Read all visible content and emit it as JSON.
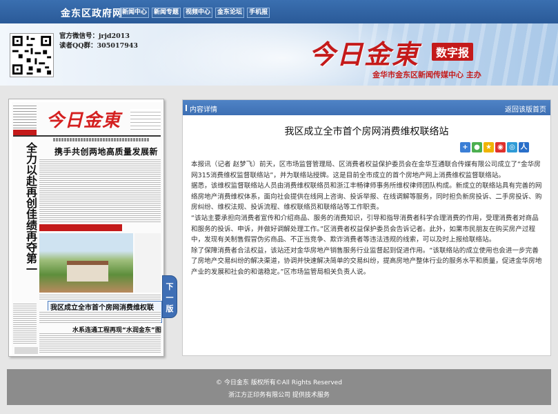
{
  "site": {
    "name": "金东区政府网",
    "nav": [
      "新闻中心",
      "新闻专题",
      "视频中心",
      "金东论坛",
      "手机报"
    ]
  },
  "banner": {
    "wechat": "官方微信号：jrjd2013",
    "qq": "读者QQ群：305017943",
    "logo_title": "今日金東",
    "logo_sub": "数字报",
    "tagline": "金华市金东区新闻传媒中心 主办"
  },
  "paper": {
    "masthead": "今日金東",
    "vertical_headline": "全力以赴再创佳绩再夺第一",
    "headline_main": "携手共创两地高质量发展新局面",
    "headline_article": "我区成立全市首个房网消费维权联络站",
    "headline_water": "水系连通工程再现“水润金东”图景",
    "next_page": "下一版"
  },
  "article": {
    "section_label": "内容详情",
    "back_link": "返回该版首页",
    "title": "我区成立全市首个房网消费维权联络站",
    "share_icons": [
      "plus-icon",
      "wechat-icon",
      "qzone-icon",
      "weibo-icon",
      "tencent-weibo-icon",
      "renren-icon"
    ],
    "paragraphs": [
      "本报讯（记者 赵梦飞）前天，区市场监督管理局、区消费者权益保护委员会在金华互通联合传媒有限公司成立了“金华房网315消费维权监督联络站”，并为联络站授牌。这是目前全市成立的首个房地产网上消费维权监督联络站。",
      "据悉，该维权监督联络站人员由消费维权联络员和浙江丰畅律师事务所维权律师团队构成。新成立的联络站具有完善的网络房地产消费维权体系，面向社会提供在线网上咨询、投诉举报、在线调解等服务，同时担负新房投诉、二手房投诉、购房纠纷、维权法规、投诉流程、维权联络员和联络站等工作职责。",
      "“该站主要承担向消费者宣传和介绍商品、服务的消费知识，引导和指导消费者科学合理消费的作用，受理消费者对商品和服务的投诉、申诉，并做好调解处理工作。”区消费者权益保护委员会告诉记者。此外，如果市民朋友在购买房产过程中，发现有关制售假冒伪劣商品、不正当竞争、欺诈消费者等违法违规的线索，可以及时上报给联络站。",
      "除了保障消费者合法权益，该站还对金华房地产销售服务行业监督起到促进作用。“该联络站的成立使用也会进一步完善了房地产交易纠纷的解决渠道，协调并快速解决简单的交易纠纷，提高房地产整体行业的服务水平和质量，促进金华房地产业的发展和社会的和谐稳定。”区市场监管局相关负责人说。"
    ]
  },
  "footer": {
    "line1": "© 今日金东 版权所有©All Rights Reserved",
    "line2": "浙江方正印务有限公司 提供技术服务"
  },
  "colors": {
    "nav_blue": "#2a5a98",
    "logo_red": "#c41a1a",
    "bar_blue": "#4f83c6",
    "footer_gray": "#8c8c8c"
  }
}
